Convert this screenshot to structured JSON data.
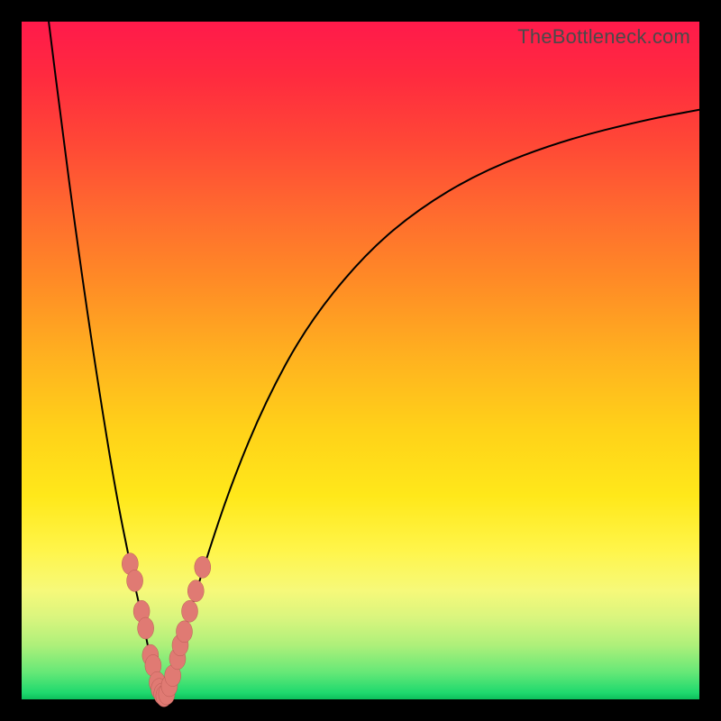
{
  "watermark": "TheBottleneck.com",
  "chart_data": {
    "type": "line",
    "title": "",
    "xlabel": "",
    "ylabel": "",
    "xlim": [
      0,
      100
    ],
    "ylim": [
      0,
      100
    ],
    "grid": false,
    "legend": false,
    "series": [
      {
        "name": "left-curve",
        "x": [
          4,
          6,
          8,
          10,
          12,
          14,
          16,
          18,
          19,
          20,
          21
        ],
        "y": [
          100,
          84,
          69,
          55,
          42,
          30,
          20,
          11,
          6,
          2.5,
          0.5
        ]
      },
      {
        "name": "right-curve",
        "x": [
          21,
          22,
          24,
          27,
          31,
          36,
          42,
          50,
          58,
          68,
          80,
          92,
          100
        ],
        "y": [
          0.5,
          3,
          10,
          20,
          32,
          44,
          55,
          65,
          72,
          78,
          82.5,
          85.5,
          87
        ]
      }
    ],
    "beads": {
      "left": [
        {
          "x": 16,
          "y": 20
        },
        {
          "x": 16.7,
          "y": 17.5
        },
        {
          "x": 17.7,
          "y": 13
        },
        {
          "x": 18.3,
          "y": 10.5
        },
        {
          "x": 19,
          "y": 6.5
        },
        {
          "x": 19.4,
          "y": 5
        },
        {
          "x": 20,
          "y": 2.5
        },
        {
          "x": 20.3,
          "y": 1.5
        }
      ],
      "bottom": [
        {
          "x": 20.7,
          "y": 0.8
        },
        {
          "x": 21,
          "y": 0.5
        },
        {
          "x": 21.4,
          "y": 0.8
        }
      ],
      "right": [
        {
          "x": 21.8,
          "y": 2
        },
        {
          "x": 22.3,
          "y": 3.5
        },
        {
          "x": 23,
          "y": 6
        },
        {
          "x": 23.4,
          "y": 8
        },
        {
          "x": 24,
          "y": 10
        },
        {
          "x": 24.8,
          "y": 13
        },
        {
          "x": 25.7,
          "y": 16
        },
        {
          "x": 26.7,
          "y": 19.5
        }
      ]
    },
    "annotations": []
  }
}
